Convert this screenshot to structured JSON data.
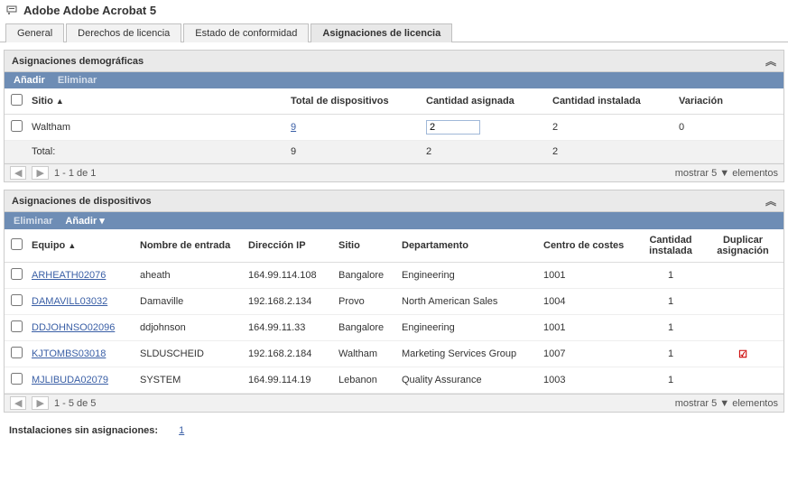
{
  "window": {
    "title": "Adobe Adobe Acrobat 5"
  },
  "tabs": {
    "general": "General",
    "license_rights": "Derechos de licencia",
    "compliance": "Estado de conformidad",
    "assignments": "Asignaciones de licencia"
  },
  "demographic": {
    "title": "Asignaciones demográficas",
    "add": "Añadir",
    "remove": "Eliminar",
    "cols": {
      "site": "Sitio",
      "total_devices": "Total de dispositivos",
      "qty_assigned": "Cantidad asignada",
      "qty_installed": "Cantidad instalada",
      "variance": "Variación"
    },
    "row": {
      "site": "Waltham",
      "total_devices": "9",
      "qty_assigned": "2",
      "qty_installed": "2",
      "variance": "0"
    },
    "totals_label": "Total:",
    "totals": {
      "devices": "9",
      "assigned": "2",
      "installed": "2"
    },
    "pager": {
      "range": "1 - 1 de 1",
      "show": "mostrar",
      "count": "5",
      "items": "elementos"
    }
  },
  "devices": {
    "title": "Asignaciones de dispositivos",
    "remove": "Eliminar",
    "add": "Añadir",
    "cols": {
      "machine": "Equipo",
      "login": "Nombre de entrada",
      "ip": "Dirección IP",
      "site": "Sitio",
      "dept": "Departamento",
      "costcenter": "Centro de costes",
      "qty_installed1": "Cantidad",
      "qty_installed2": "instalada",
      "dup1": "Duplicar",
      "dup2": "asignación"
    },
    "rows": [
      {
        "machine": "ARHEATH02076",
        "login": "aheath",
        "ip": "164.99.114.108",
        "site": "Bangalore",
        "dept": "Engineering",
        "cc": "1001",
        "qty": "1",
        "dup": false
      },
      {
        "machine": "DAMAVILL03032",
        "login": "Damaville",
        "ip": "192.168.2.134",
        "site": "Provo",
        "dept": "North American Sales",
        "cc": "1004",
        "qty": "1",
        "dup": false
      },
      {
        "machine": "DDJOHNSO02096",
        "login": "ddjohnson",
        "ip": "164.99.11.33",
        "site": "Bangalore",
        "dept": "Engineering",
        "cc": "1001",
        "qty": "1",
        "dup": false
      },
      {
        "machine": "KJTOMBS03018",
        "login": "SLDUSCHEID",
        "ip": "192.168.2.184",
        "site": "Waltham",
        "dept": "Marketing Services Group",
        "cc": "1007",
        "qty": "1",
        "dup": true
      },
      {
        "machine": "MJLIBUDA02079",
        "login": "SYSTEM",
        "ip": "164.99.114.19",
        "site": "Lebanon",
        "dept": "Quality Assurance",
        "cc": "1003",
        "qty": "1",
        "dup": false
      }
    ],
    "pager": {
      "range": "1 - 5 de 5",
      "show": "mostrar",
      "count": "5",
      "items": "elementos"
    }
  },
  "unassigned": {
    "label": "Instalaciones sin asignaciones:",
    "count": "1"
  }
}
